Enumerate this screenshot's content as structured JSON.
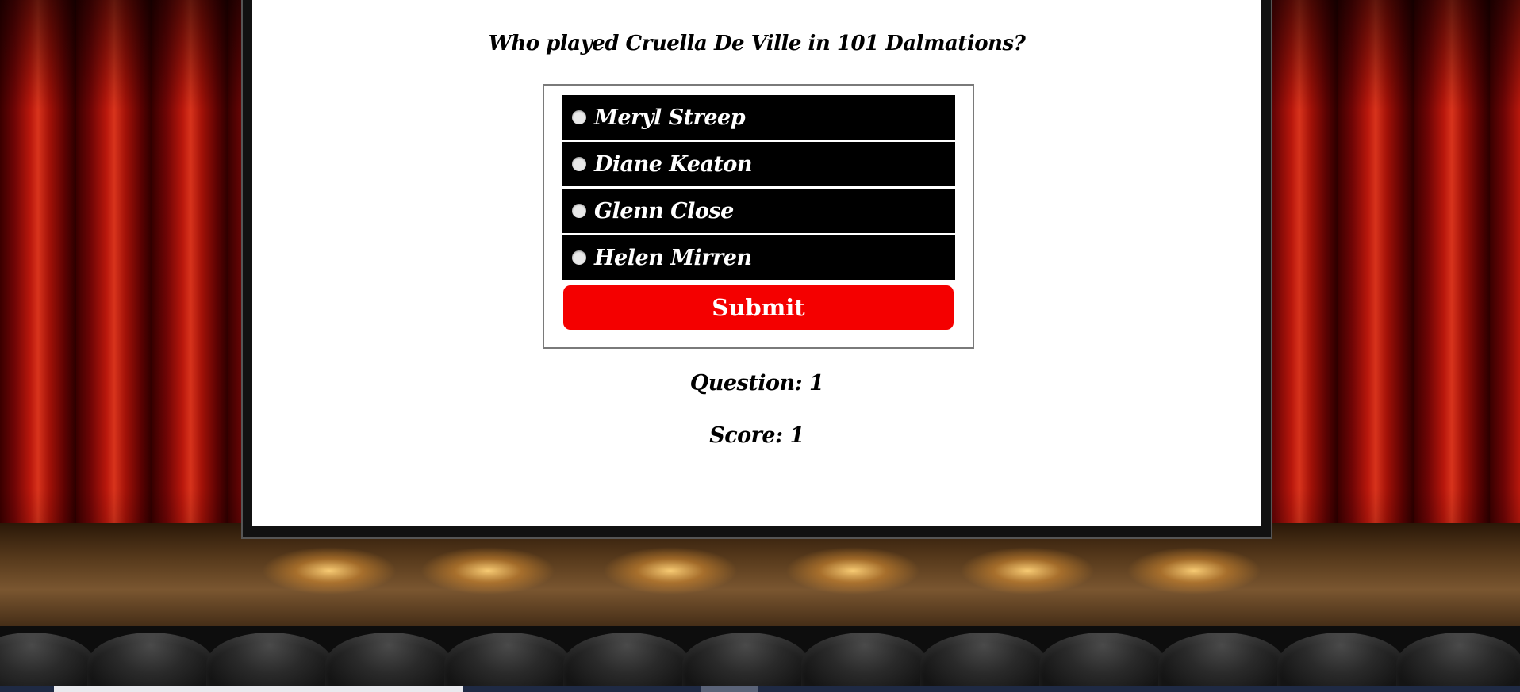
{
  "quiz": {
    "question": "Who played Cruella De Ville in 101 Dalmations?",
    "choices": [
      {
        "label": "Meryl Streep"
      },
      {
        "label": "Diane Keaton"
      },
      {
        "label": "Glenn Close"
      },
      {
        "label": "Helen Mirren"
      }
    ],
    "submit_label": "Submit",
    "question_status": "Question: 1",
    "score_status": "Score: 1"
  },
  "colors": {
    "submit_background": "#f40000",
    "choice_background": "#000000",
    "screen_background": "#ffffff",
    "curtain": "#b8170c"
  },
  "icons": {
    "choice_marker": "radio-button-icon"
  }
}
